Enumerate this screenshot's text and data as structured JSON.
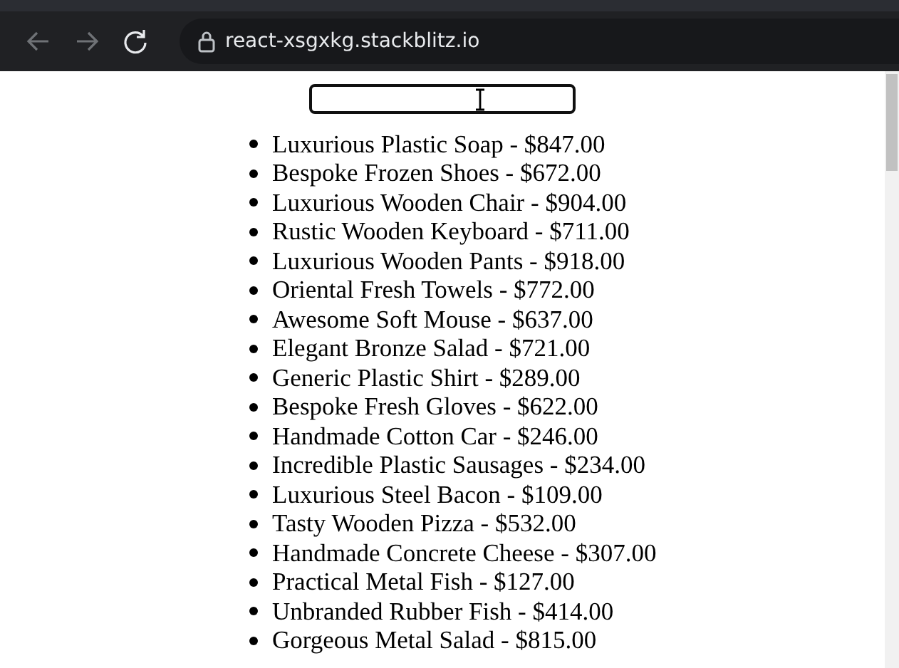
{
  "browser": {
    "url": "react-xsgxkg.stackblitz.io",
    "back": {
      "disabled": true
    },
    "forward": {
      "disabled": true
    }
  },
  "search": {
    "focused": true
  },
  "products": [
    {
      "text": "Luxurious Plastic Soap - $847.00"
    },
    {
      "text": "Bespoke Frozen Shoes - $672.00"
    },
    {
      "text": "Luxurious Wooden Chair - $904.00"
    },
    {
      "text": "Rustic Wooden Keyboard - $711.00"
    },
    {
      "text": "Luxurious Wooden Pants - $918.00"
    },
    {
      "text": "Oriental Fresh Towels - $772.00"
    },
    {
      "text": "Awesome Soft Mouse - $637.00"
    },
    {
      "text": "Elegant Bronze Salad - $721.00"
    },
    {
      "text": "Generic Plastic Shirt - $289.00"
    },
    {
      "text": "Bespoke Fresh Gloves - $622.00"
    },
    {
      "text": "Handmade Cotton Car - $246.00"
    },
    {
      "text": "Incredible Plastic Sausages - $234.00"
    },
    {
      "text": "Luxurious Steel Bacon - $109.00"
    },
    {
      "text": "Tasty Wooden Pizza - $532.00"
    },
    {
      "text": "Handmade Concrete Cheese - $307.00"
    },
    {
      "text": "Practical Metal Fish - $127.00"
    },
    {
      "text": "Unbranded Rubber Fish - $414.00"
    },
    {
      "text": "Gorgeous Metal Salad - $815.00"
    }
  ]
}
